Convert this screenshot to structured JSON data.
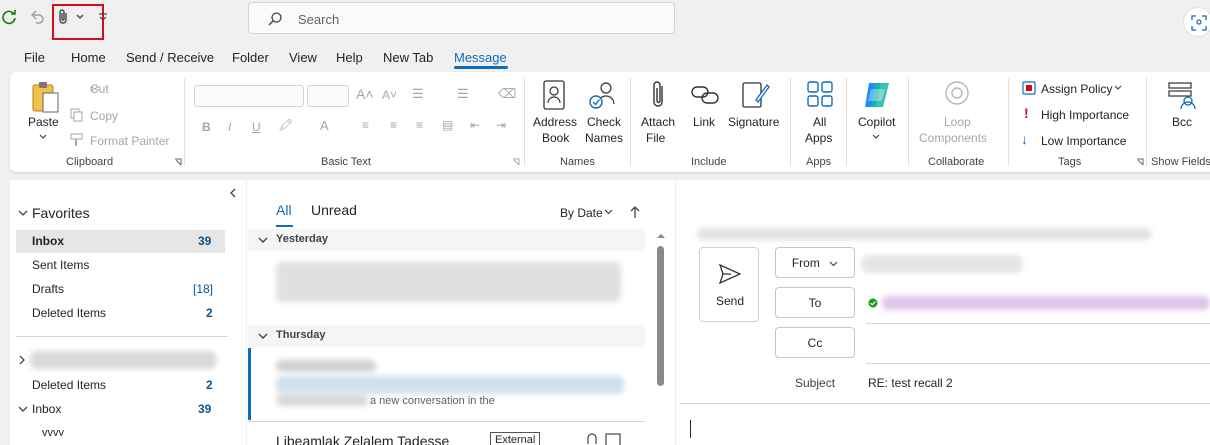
{
  "titlebar": {
    "search_placeholder": "Search"
  },
  "menu": [
    {
      "label": "File",
      "active": false
    },
    {
      "label": "Home",
      "active": false
    },
    {
      "label": "Send / Receive",
      "active": false
    },
    {
      "label": "Folder",
      "active": false
    },
    {
      "label": "View",
      "active": false
    },
    {
      "label": "Help",
      "active": false
    },
    {
      "label": "New Tab",
      "active": false
    },
    {
      "label": "Message",
      "active": true
    }
  ],
  "ribbon": {
    "clipboard": {
      "paste": "Paste",
      "cut": "Cut",
      "copy": "Copy",
      "format_painter": "Format Painter",
      "label": "Clipboard"
    },
    "basic_text": {
      "label": "Basic Text"
    },
    "names": {
      "address_book_1": "Address",
      "address_book_2": "Book",
      "check_names_1": "Check",
      "check_names_2": "Names",
      "label": "Names"
    },
    "include": {
      "attach_1": "Attach",
      "attach_2": "File",
      "link": "Link",
      "signature": "Signature",
      "label": "Include"
    },
    "apps": {
      "all_apps_1": "All",
      "all_apps_2": "Apps",
      "label": "Apps"
    },
    "copilot": {
      "label": "Copilot"
    },
    "collaborate": {
      "loop_1": "Loop",
      "loop_2": "Components",
      "label": "Collaborate"
    },
    "tags": {
      "assign_policy": "Assign Policy",
      "high_importance": "High Importance",
      "low_importance": "Low Importance",
      "label": "Tags"
    },
    "show_fields": {
      "bcc": "Bcc",
      "label": "Show Fields"
    }
  },
  "folders": {
    "favorites": "Favorites",
    "items": [
      {
        "label": "Inbox",
        "count": "39"
      },
      {
        "label": "Sent Items",
        "count": ""
      },
      {
        "label": "Drafts",
        "count": "[18]"
      },
      {
        "label": "Deleted Items",
        "count": "2"
      }
    ],
    "account_items": [
      {
        "label": "Deleted Items",
        "count": "2"
      },
      {
        "label": "Inbox",
        "count": "39"
      },
      {
        "label": "vvvv",
        "count": ""
      }
    ]
  },
  "list": {
    "tab_all": "All",
    "tab_unread": "Unread",
    "sort": "By Date",
    "group_yesterday": "Yesterday",
    "group_thursday": "Thursday",
    "partial_text": "a new conversation in the",
    "sender": "Libeamlak Zelalem Tadesse",
    "external_badge": "External"
  },
  "compose": {
    "send": "Send",
    "from": "From",
    "to": "To",
    "cc": "Cc",
    "subject_label": "Subject",
    "subject_value": "RE: test recall 2"
  },
  "colors": {
    "accent": "#0f6cbd",
    "highlight_box": "#d0111b"
  }
}
